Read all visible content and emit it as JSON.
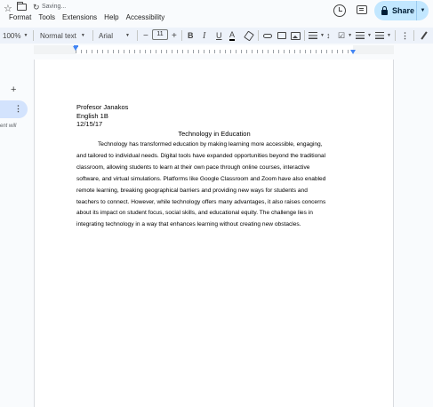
{
  "topbar": {
    "status": "Saving...",
    "menus": [
      "Format",
      "Tools",
      "Extensions",
      "Help",
      "Accessibility"
    ],
    "share_label": "Share"
  },
  "toolbar": {
    "zoom": "100%",
    "style": "Normal text",
    "font": "Arial",
    "font_size": "11",
    "minus": "−",
    "plus": "+",
    "bold": "B",
    "italic": "I",
    "underline": "U",
    "text_color": "A"
  },
  "sidebar": {
    "add": "+",
    "more": "⋮",
    "cut_text": "ent will"
  },
  "document": {
    "header_lines": [
      "Profesor Janakos",
      "English 1B",
      "12/15/17"
    ],
    "title": "Technology in Education",
    "paragraph_lines": [
      "Technology has transformed education by making learning more accessible, engaging,",
      "and tailored to individual needs. Digital tools have expanded opportunities beyond the traditional",
      "classroom, allowing students to learn at their own pace through online courses, interactive",
      "software, and virtual simulations. Platforms like Google Classroom and Zoom have also enabled",
      "remote learning, breaking geographical barriers and providing new ways for students and",
      "teachers to connect. However, while technology offers many advantages, it also raises concerns",
      "about its impact on student focus, social skills, and educational equity. The challenge lies in",
      "integrating technology in a way that enhances learning without creating new obstacles."
    ]
  },
  "colors": {
    "share_bg": "#c2e7ff",
    "toolbar_bg": "#edf2fa",
    "ruler_marker": "#4285f4"
  }
}
